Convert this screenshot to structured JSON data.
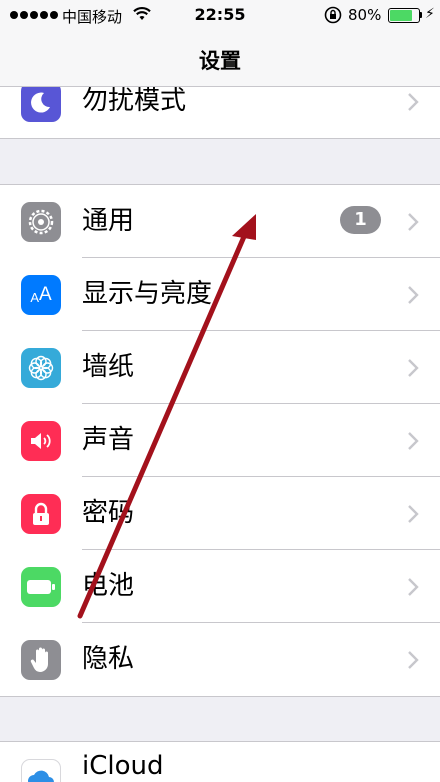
{
  "status_bar": {
    "carrier": "中国移动",
    "time": "22:55",
    "battery_percent": "80%"
  },
  "nav": {
    "title": "设置"
  },
  "groups": [
    {
      "items": [
        {
          "label": "勿扰模式",
          "icon": "moon-icon",
          "color": "#5856d6"
        }
      ]
    },
    {
      "items": [
        {
          "label": "通用",
          "icon": "gear-icon",
          "color": "#8e8e93",
          "badge": "1"
        },
        {
          "label": "显示与亮度",
          "icon": "text-size-icon",
          "color": "#007aff"
        },
        {
          "label": "墙纸",
          "icon": "flower-icon",
          "color": "#35aad9"
        },
        {
          "label": "声音",
          "icon": "speaker-icon",
          "color": "#ff2d55"
        },
        {
          "label": "密码",
          "icon": "padlock-icon",
          "color": "#ff2d55"
        },
        {
          "label": "电池",
          "icon": "battery-icon",
          "color": "#4cd964"
        },
        {
          "label": "隐私",
          "icon": "hand-icon",
          "color": "#8e8e93"
        }
      ]
    },
    {
      "items": [
        {
          "label": "iCloud",
          "icon": "cloud-icon",
          "color": "#ffffff"
        }
      ]
    }
  ]
}
